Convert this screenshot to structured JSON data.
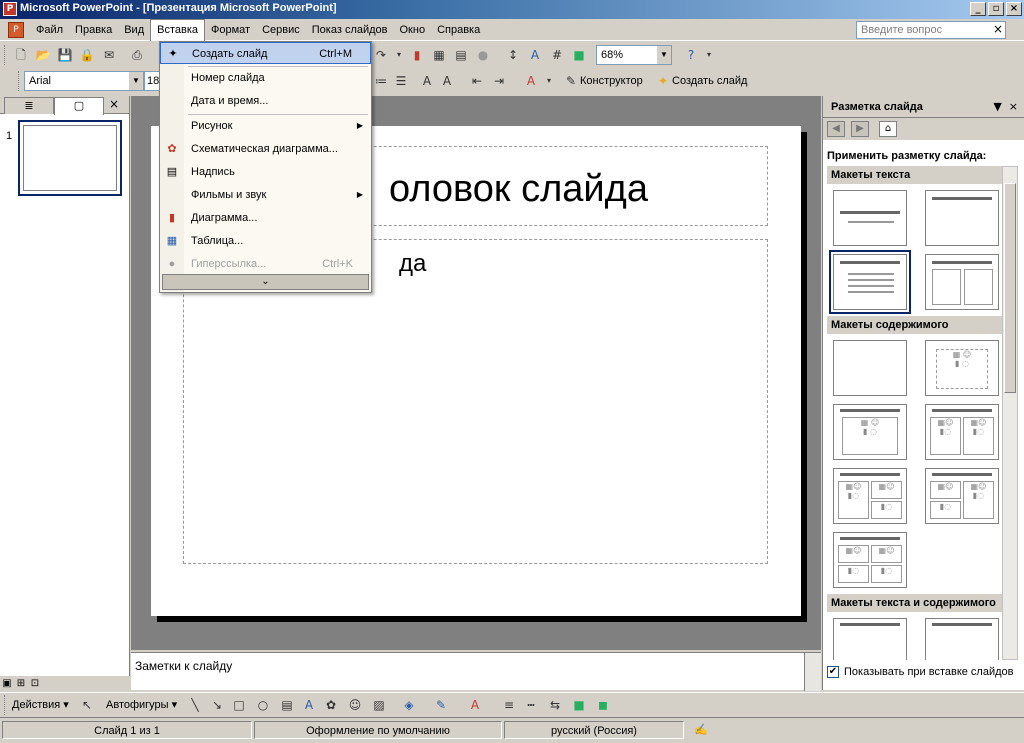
{
  "window": {
    "title": "Microsoft PowerPoint - [Презентация Microsoft PowerPoint]",
    "app_icon": "powerpoint-icon",
    "controls": [
      "minimize",
      "maximize",
      "close"
    ]
  },
  "menubar": {
    "items": [
      "Файл",
      "Правка",
      "Вид",
      "Вставка",
      "Формат",
      "Сервис",
      "Показ слайдов",
      "Окно",
      "Справка"
    ],
    "open_index": 3,
    "ask_placeholder": "Введите вопрос"
  },
  "toolbar1": {
    "zoom": "68%"
  },
  "toolbar2": {
    "font": "Arial",
    "font_size": "18",
    "designer_label": "Конструктор",
    "new_slide_label": "Создать слайд"
  },
  "insert_menu": {
    "items": [
      {
        "label": "Создать слайд",
        "shortcut": "Ctrl+M",
        "icon": "new-slide-icon",
        "highlighted": true
      },
      {
        "label": "Номер слайда"
      },
      {
        "label": "Дата и время..."
      },
      {
        "label": "Рисунок",
        "submenu": true
      },
      {
        "label": "Схематическая диаграмма...",
        "icon": "diagram-icon"
      },
      {
        "label": "Надпись",
        "icon": "textbox-icon"
      },
      {
        "label": "Фильмы и звук",
        "submenu": true
      },
      {
        "label": "Диаграмма...",
        "icon": "chart-icon"
      },
      {
        "label": "Таблица...",
        "icon": "table-icon"
      },
      {
        "label": "Гиперссылка...",
        "shortcut": "Ctrl+K",
        "icon": "hyperlink-icon",
        "disabled": true
      }
    ]
  },
  "slides_panel": {
    "slide_number": "1"
  },
  "slide": {
    "title_placeholder": "оловок слайда",
    "body_placeholder": "да"
  },
  "notes": {
    "placeholder": "Заметки к слайду"
  },
  "taskpane": {
    "title": "Разметка слайда",
    "apply_label": "Применить разметку слайда:",
    "sections": [
      "Макеты текста",
      "Макеты содержимого",
      "Макеты текста и содержимого"
    ],
    "show_on_insert_label": "Показывать при вставке слайдов",
    "show_on_insert_checked": true
  },
  "drawbar": {
    "actions_label": "Действия",
    "autoshapes_label": "Автофигуры"
  },
  "statusbar": {
    "slide_info": "Слайд 1 из 1",
    "design": "Оформление по умолчанию",
    "language": "русский (Россия)"
  },
  "colors": {
    "titlebar_start": "#0a246a",
    "menu_highlight": "#c1d2ee",
    "workspace_gray": "#808080"
  }
}
